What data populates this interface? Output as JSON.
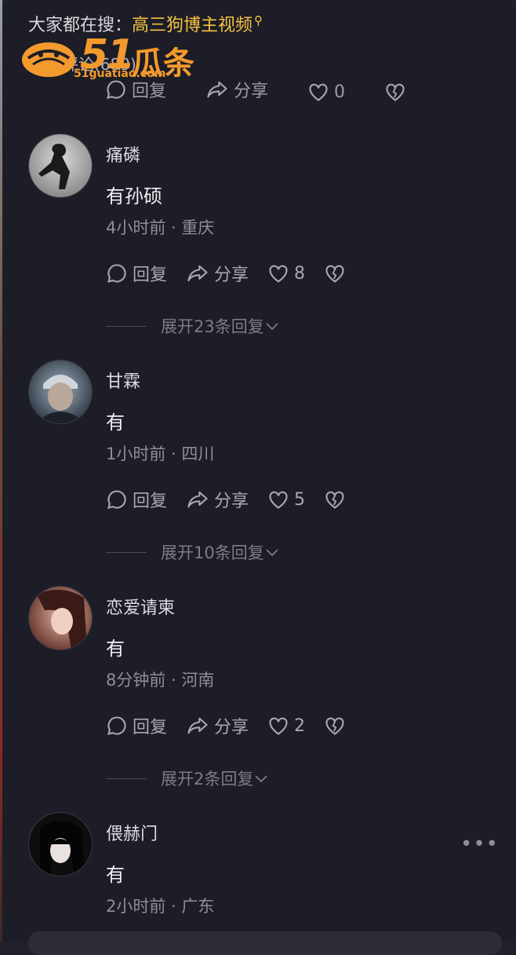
{
  "search_hint": {
    "prefix": "大家都在搜：",
    "keyword": "高三狗博主视频"
  },
  "header": {
    "title": "全部评论(689)"
  },
  "watermark": {
    "number": "51",
    "text": "瓜条",
    "url": "51guatiao.com"
  },
  "partial_actions": {
    "reply": "回复",
    "share": "分享",
    "likes": "0"
  },
  "comments": [
    {
      "username": "痛磷",
      "content": "有孙硕",
      "meta": "4小时前 · 重庆",
      "reply": "回复",
      "share": "分享",
      "likes": "8",
      "expand": "展开23条回复"
    },
    {
      "username": "甘霖",
      "content": "有",
      "meta": "1小时前 · 四川",
      "reply": "回复",
      "share": "分享",
      "likes": "5",
      "expand": "展开10条回复"
    },
    {
      "username": "恋爱请柬",
      "content": "有",
      "meta": "8分钟前 · 河南",
      "reply": "回复",
      "share": "分享",
      "likes": "2",
      "expand": "展开2条回复"
    },
    {
      "username": "偎赫门",
      "content": "有",
      "meta": "2小时前 · 广东"
    }
  ],
  "more_label": "•••",
  "colors": {
    "background": "#1c1d26",
    "keyword": "#f5c242",
    "logo": "#f39a2e"
  }
}
